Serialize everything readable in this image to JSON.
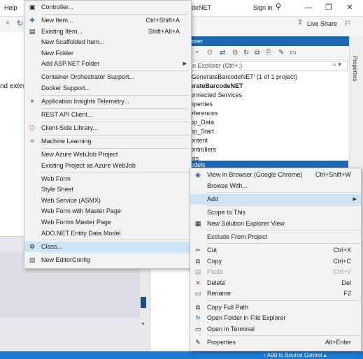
{
  "titlebar": {
    "help_label": "Help",
    "title": "deNET",
    "signin_label": "Sign in",
    "minimize": "—",
    "restore": "❐",
    "close": "✕"
  },
  "toolbar": {
    "liveshare_label": "Live Share"
  },
  "editor": {
    "partial_text": "nd exter"
  },
  "solution_explorer": {
    "header_title": "lorer",
    "search_placeholder": "n Explorer (Ctrl+;)",
    "tree": [
      "'GenerateBarcodeNET' (1 of 1 project)",
      "erateBarcodeNET",
      "onnected Services",
      "operties",
      "eferences",
      "pp_Data",
      "pp_Start",
      "ontent",
      "ontrollers",
      "nts"
    ],
    "selected_item": "odels"
  },
  "properties_tab": "Properties",
  "statusbar": {
    "source_control": "↑ Add to Source Control ▴"
  },
  "add_menu": {
    "items": [
      {
        "label": "Controller...",
        "shortcut": "",
        "icon": "controller-icon"
      },
      {
        "sep": true
      },
      {
        "label": "New Item...",
        "shortcut": "Ctrl+Shift+A",
        "icon": "new-item-icon"
      },
      {
        "label": "Existing Item...",
        "shortcut": "Shift+Alt+A",
        "icon": "existing-item-icon"
      },
      {
        "label": "New Scaffolded Item...",
        "shortcut": "",
        "icon": ""
      },
      {
        "label": "New Folder",
        "shortcut": "",
        "icon": ""
      },
      {
        "label": "Add ASP.NET Folder",
        "shortcut": "",
        "icon": "",
        "submenu": true
      },
      {
        "sep": true
      },
      {
        "label": "Container Orchestrator Support...",
        "shortcut": "",
        "icon": ""
      },
      {
        "label": "Docker Support...",
        "shortcut": "",
        "icon": ""
      },
      {
        "sep": true
      },
      {
        "label": "Application Insights Telemetry...",
        "shortcut": "",
        "icon": "app-insights-icon"
      },
      {
        "sep": true
      },
      {
        "label": "REST API Client...",
        "shortcut": "",
        "icon": ""
      },
      {
        "sep": true
      },
      {
        "label": "Client-Side Library...",
        "shortcut": "",
        "icon": "client-library-icon"
      },
      {
        "sep": true
      },
      {
        "label": "Machine Learning",
        "shortcut": "",
        "icon": "machine-learning-icon"
      },
      {
        "sep": true
      },
      {
        "label": "New Azure WebJob Project",
        "shortcut": "",
        "icon": ""
      },
      {
        "label": "Existing Project as Azure WebJob",
        "shortcut": "",
        "icon": ""
      },
      {
        "sep": true
      },
      {
        "label": "Web Form",
        "shortcut": "",
        "icon": ""
      },
      {
        "label": "Style Sheet",
        "shortcut": "",
        "icon": ""
      },
      {
        "label": "Web Service (ASMX)",
        "shortcut": "",
        "icon": ""
      },
      {
        "label": "Web Form with Master Page",
        "shortcut": "",
        "icon": ""
      },
      {
        "label": "Web Forms Master Page",
        "shortcut": "",
        "icon": ""
      },
      {
        "label": "ADO.NET Entity Data Model",
        "shortcut": "",
        "icon": ""
      },
      {
        "sep": true
      },
      {
        "label": "Class...",
        "shortcut": "",
        "icon": "class-icon",
        "selected": true
      },
      {
        "sep": true
      },
      {
        "label": "New EditorConfig",
        "shortcut": "",
        "icon": "editorconfig-icon"
      }
    ]
  },
  "context_menu": {
    "items": [
      {
        "label": "View in Browser (Google Chrome)",
        "shortcut": "Ctrl+Shift+W",
        "icon": "browser-icon"
      },
      {
        "label": "Browse With...",
        "shortcut": "",
        "icon": ""
      },
      {
        "sep": true
      },
      {
        "label": "Add",
        "shortcut": "",
        "icon": "",
        "submenu": true,
        "selected": true
      },
      {
        "sep": true
      },
      {
        "label": "Scope to This",
        "shortcut": "",
        "icon": ""
      },
      {
        "label": "New Solution Explorer View",
        "shortcut": "",
        "icon": "new-view-icon"
      },
      {
        "sep": true
      },
      {
        "label": "Exclude From Project",
        "shortcut": "",
        "icon": ""
      },
      {
        "sep": true
      },
      {
        "label": "Cut",
        "shortcut": "Ctrl+X",
        "icon": "cut-icon"
      },
      {
        "label": "Copy",
        "shortcut": "Ctrl+C",
        "icon": "copy-icon"
      },
      {
        "label": "Paste",
        "shortcut": "Ctrl+V",
        "icon": "paste-icon",
        "disabled": true
      },
      {
        "label": "Delete",
        "shortcut": "Del",
        "icon": "delete-icon"
      },
      {
        "label": "Rename",
        "shortcut": "F2",
        "icon": "rename-icon"
      },
      {
        "sep": true
      },
      {
        "label": "Copy Full Path",
        "shortcut": "",
        "icon": "copy-path-icon"
      },
      {
        "label": "Open Folder in File Explorer",
        "shortcut": "",
        "icon": "open-folder-icon"
      },
      {
        "label": "Open in Terminal",
        "shortcut": "",
        "icon": "terminal-icon"
      },
      {
        "sep": true
      },
      {
        "label": "Properties",
        "shortcut": "Alt+Enter",
        "icon": "properties-icon"
      }
    ]
  },
  "colors": {
    "accent": "#1c68b2",
    "menu_bg": "#f2f2f2",
    "menu_highlight": "#cde3f6",
    "statusbar": "#1c7ad4"
  }
}
